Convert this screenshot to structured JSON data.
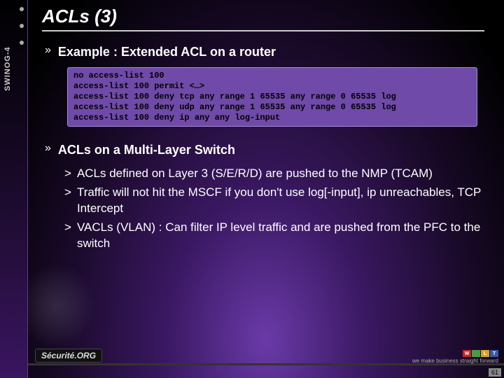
{
  "sidebar": {
    "label": "SWINOG-4"
  },
  "title": "ACLs (3)",
  "section1": {
    "heading": "Example : Extended ACL on a router",
    "code": "no access-list 100\naccess-list 100 permit <…>\naccess-list 100 deny tcp any range 1 65535 any range 0 65535 log\naccess-list 100 deny udp any range 1 65535 any range 0 65535 log\naccess-list 100 deny ip any any log-input"
  },
  "section2": {
    "heading": "ACLs on a Multi-Layer Switch",
    "items": [
      "ACLs defined on Layer 3 (S/E/R/D) are pushed to the NMP (TCAM)",
      "Traffic will not hit the MSCF if you don't use log[-input], ip unreachables, TCP Intercept",
      "VACLs (VLAN) : Can filter IP level traffic and are pushed from the PFC to the switch"
    ]
  },
  "footer": {
    "logo_left": "Sécurité.ORG",
    "blocks": [
      "W",
      "",
      "L",
      "T"
    ],
    "block_colors": [
      "#c02828",
      "#4a9a4a",
      "#d8a028",
      "#3858a8"
    ],
    "tagline": "we make business straight forward",
    "page": "61"
  }
}
